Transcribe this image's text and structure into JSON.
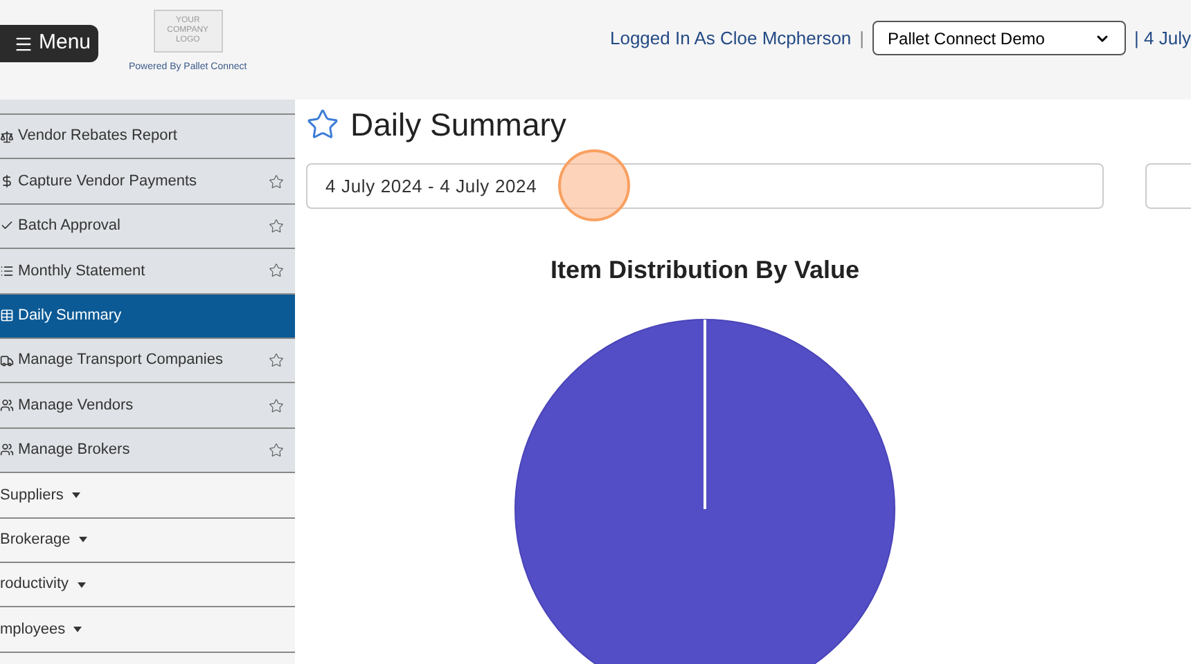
{
  "header": {
    "menu_button": "Menu",
    "logo_lines": [
      "YOUR",
      "COMPANY",
      "LOGO"
    ],
    "powered_by": "Powered By Pallet Connect",
    "logged_in": "Logged In As Cloe Mcpherson",
    "separator": "|",
    "company_select": "Pallet Connect Demo",
    "date_link": "| 4 July"
  },
  "sidebar": {
    "items": [
      {
        "kind": "link",
        "label": "Vendor Rebates Report",
        "selected": false,
        "favorite_star": false
      },
      {
        "kind": "link",
        "label": "Capture Vendor Payments",
        "selected": false,
        "favorite_star": true
      },
      {
        "kind": "link",
        "label": "Batch Approval",
        "selected": false,
        "favorite_star": true
      },
      {
        "kind": "link",
        "label": "Monthly Statement",
        "selected": false,
        "favorite_star": true
      },
      {
        "kind": "link",
        "label": "Daily Summary",
        "selected": true,
        "favorite_star": false
      },
      {
        "kind": "link",
        "label": "Manage Transport Companies",
        "selected": false,
        "favorite_star": true
      },
      {
        "kind": "link",
        "label": "Manage Vendors",
        "selected": false,
        "favorite_star": true
      },
      {
        "kind": "link",
        "label": "Manage Brokers",
        "selected": false,
        "favorite_star": true
      },
      {
        "kind": "dropdown",
        "label": "Suppliers",
        "selected": false
      },
      {
        "kind": "dropdown",
        "label": "Brokerage",
        "selected": false
      },
      {
        "kind": "dropdown",
        "label": "roductivity",
        "selected": false
      },
      {
        "kind": "dropdown",
        "label": "mployees",
        "selected": false
      }
    ]
  },
  "page": {
    "title": "Daily Summary",
    "date_range": "4 July 2024 - 4 July 2024",
    "chart_title": "Item Distribution By Value"
  }
}
